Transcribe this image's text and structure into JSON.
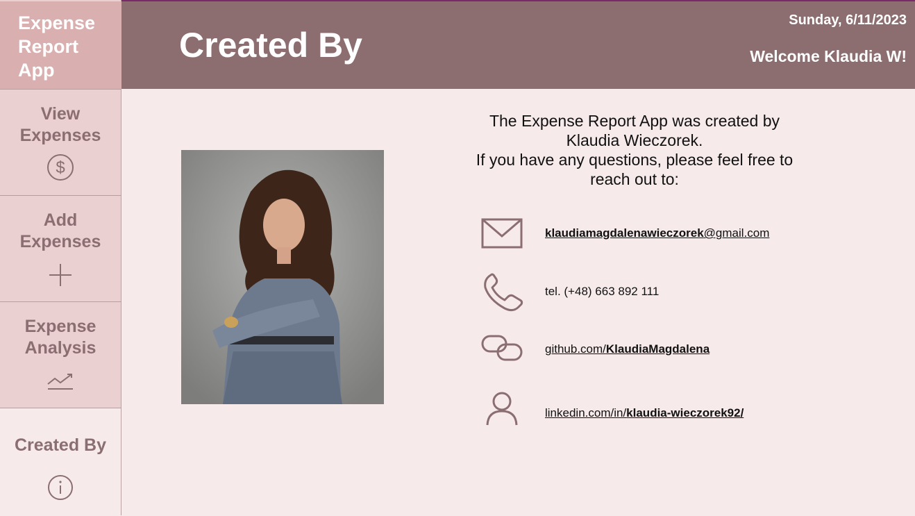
{
  "app": {
    "title": "Expense\nReport\nApp"
  },
  "header": {
    "page_title": "Created By",
    "date": "Sunday, 6/11/2023",
    "welcome": "Welcome Klaudia W!"
  },
  "sidebar": {
    "items": [
      {
        "label": "View\nExpenses",
        "icon": "dollar-icon"
      },
      {
        "label": "Add\nExpenses",
        "icon": "plus-icon"
      },
      {
        "label": "Expense\nAnalysis",
        "icon": "trend-icon"
      },
      {
        "label": "Created By",
        "icon": "info-icon",
        "active": true
      }
    ]
  },
  "main": {
    "intro": "The Expense Report App was created by\nKlaudia Wieczorek.\nIf you have any questions, please feel free to\nreach out to:",
    "email": {
      "bold": "klaudiamagdalenawieczorek",
      "rest": "@gmail.com",
      "icon": "mail-icon"
    },
    "phone": {
      "text": "tel. (+48) 663 892 111",
      "icon": "phone-icon"
    },
    "github": {
      "prefix": "github.com/",
      "bold": "KlaudiaMagdalena",
      "icon": "link-icon"
    },
    "linkedin": {
      "prefix": "linkedin.com/in/",
      "bold": "klaudia-wieczorek92/",
      "icon": "person-icon"
    }
  },
  "colors": {
    "header": "#8c6e70",
    "sidebar": "#ead0d1",
    "logo": "#d9afaf",
    "background": "#f6eaea",
    "accent": "#8b6e71"
  }
}
